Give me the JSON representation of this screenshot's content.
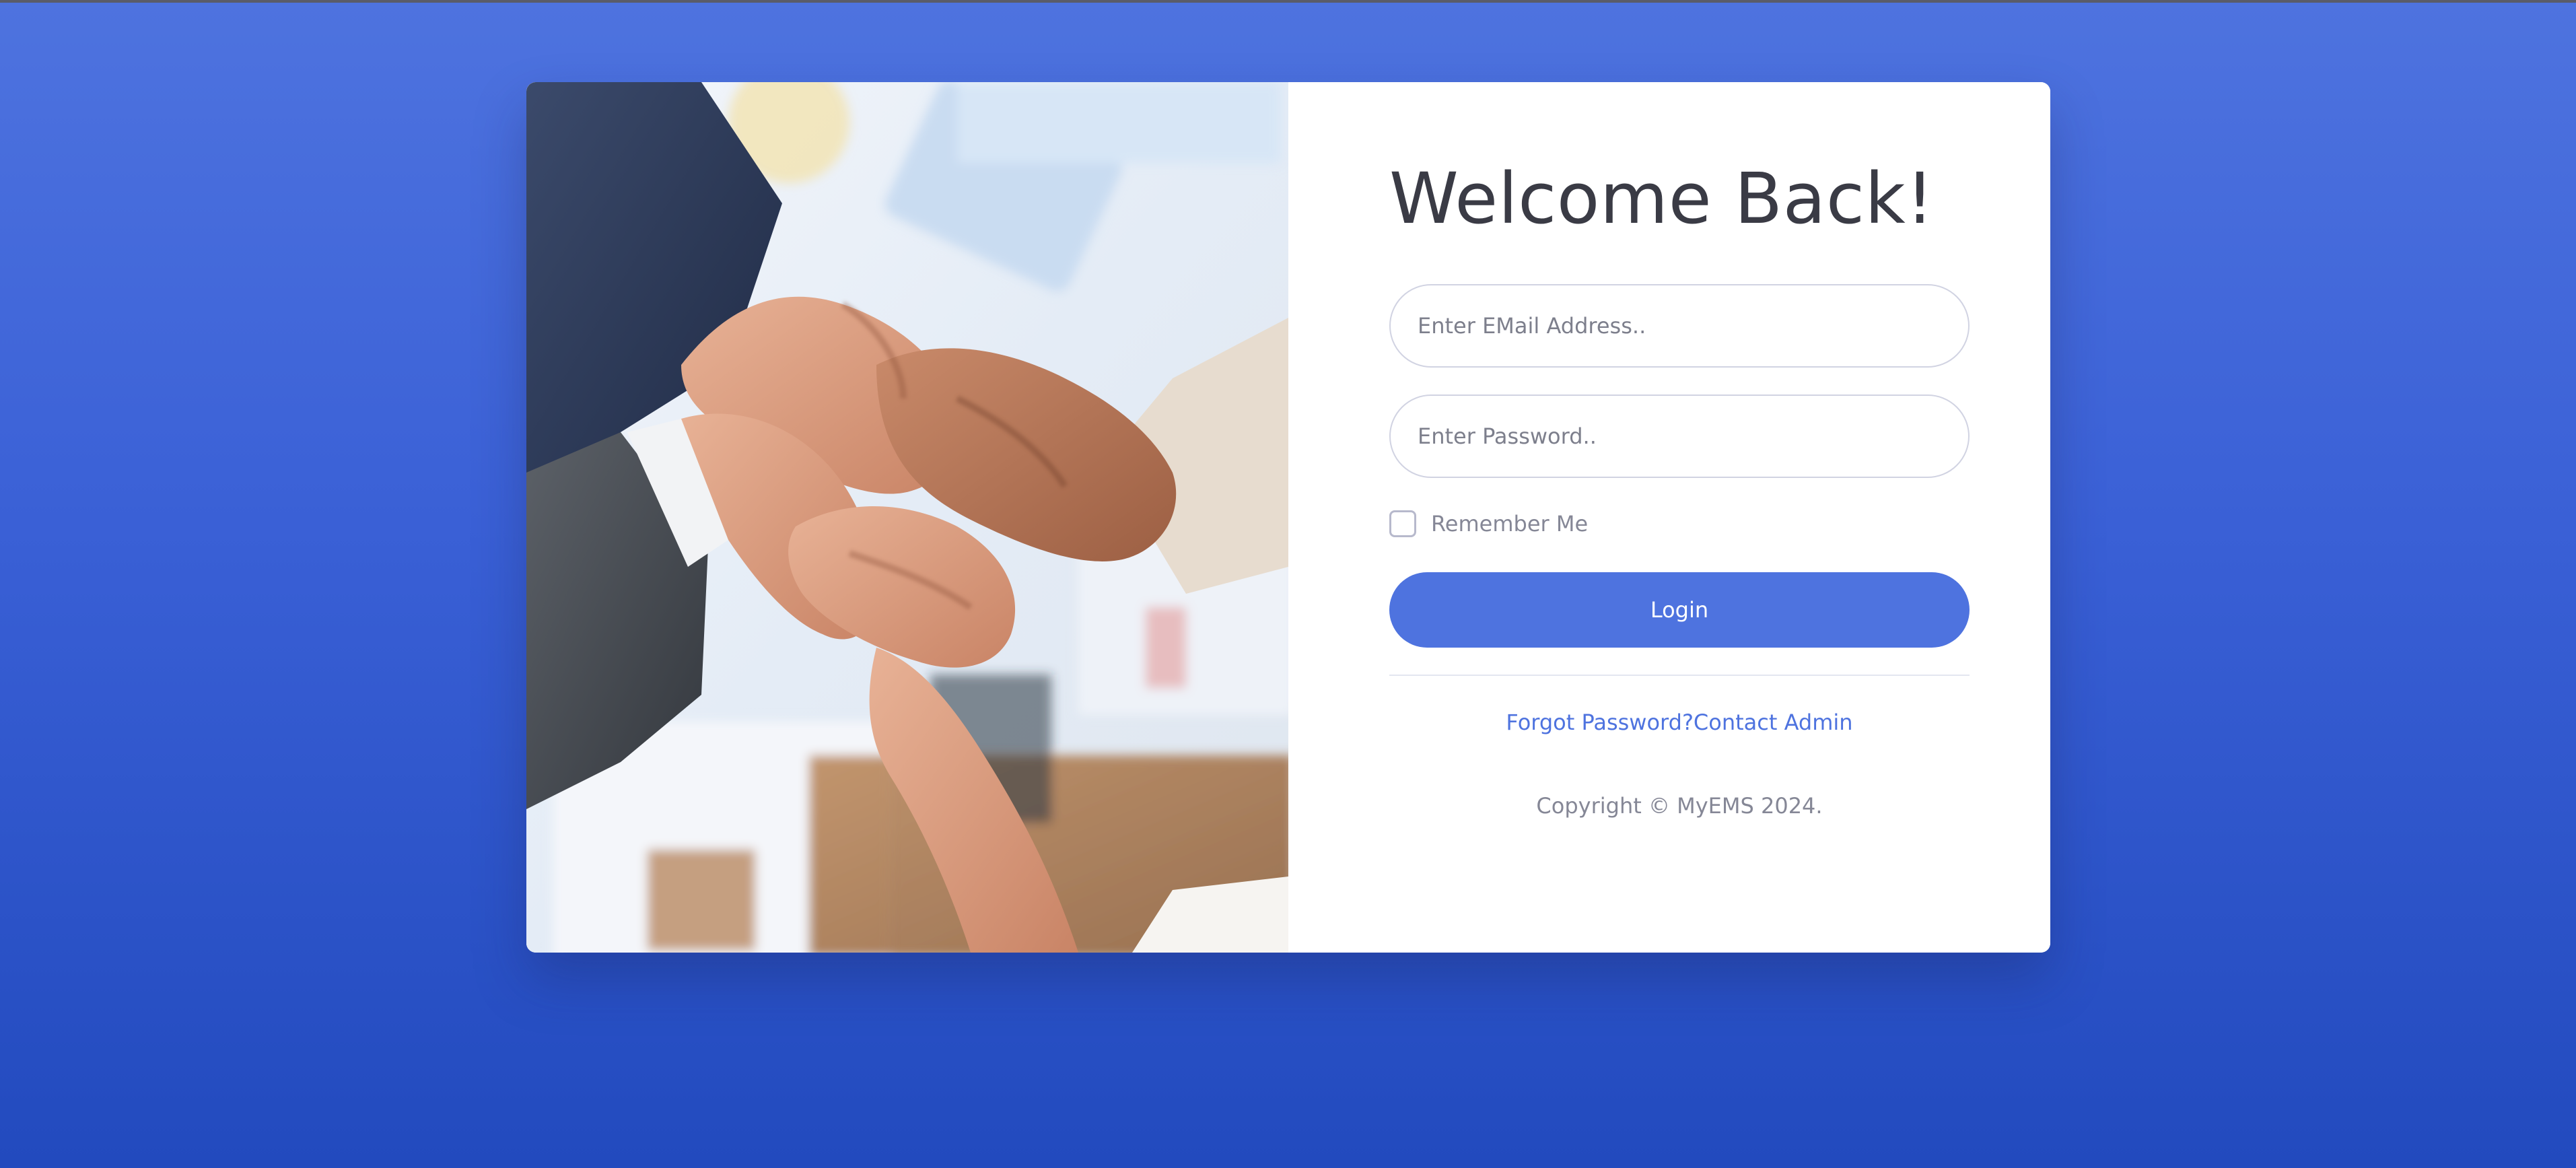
{
  "login": {
    "title": "Welcome Back!",
    "email_placeholder": "Enter EMail Address..",
    "password_placeholder": "Enter Password..",
    "remember_label": "Remember Me",
    "login_label": "Login",
    "forgot_password_label": "Forgot Password?",
    "contact_admin_label": "Contact Admin",
    "copyright": "Copyright © MyEMS 2024."
  },
  "colors": {
    "primary": "#4e73df",
    "background_top": "#4e73df",
    "background_bottom": "#224abe",
    "title_text": "#3a3b45",
    "muted_text": "#858796"
  },
  "image": {
    "description_icon": "teamwork-hands-photo"
  }
}
